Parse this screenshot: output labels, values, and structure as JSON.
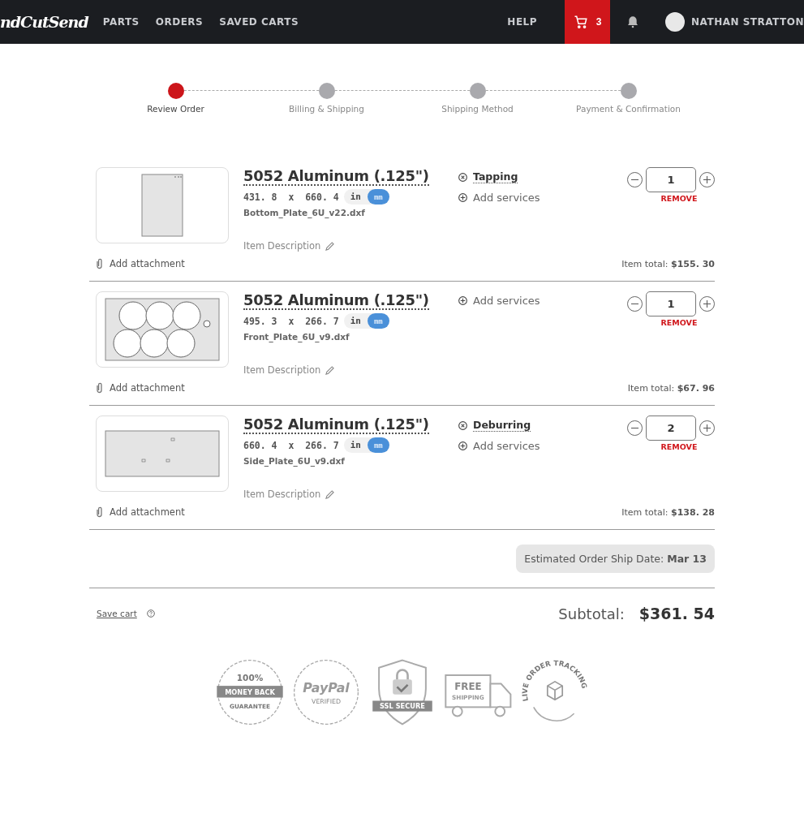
{
  "header": {
    "logo": "ndCutSend",
    "nav": [
      "PARTS",
      "ORDERS",
      "SAVED CARTS"
    ],
    "help": "HELP",
    "cart_count": "3",
    "user_name": "NATHAN STRATTON"
  },
  "steps": [
    {
      "label": "Review Order",
      "selected": true
    },
    {
      "label": "Billing & Shipping",
      "selected": false
    },
    {
      "label": "Shipping Method",
      "selected": false
    },
    {
      "label": "Payment & Confirmation",
      "selected": false
    }
  ],
  "items": [
    {
      "kind": "tall",
      "title": "5052 Aluminum (.125\")",
      "dimensions": "431. 8  x  660. 4",
      "units": [
        {
          "label": "in",
          "selected": false
        },
        {
          "label": "mm",
          "selected": true
        }
      ],
      "file": "Bottom_Plate_6U_v22.dxf",
      "description": "Item Description",
      "attachment": "Add attachment",
      "services": [
        {
          "kind": "service",
          "label": "Tapping"
        },
        {
          "kind": "add",
          "label": "Add services"
        }
      ],
      "quantity": "1",
      "remove": "REMOVE",
      "total_label": "Item total:",
      "total": "$155. 30"
    },
    {
      "kind": "holes",
      "title": "5052 Aluminum (.125\")",
      "dimensions": "495. 3  x  266. 7",
      "units": [
        {
          "label": "in",
          "selected": false
        },
        {
          "label": "mm",
          "selected": true
        }
      ],
      "file": "Front_Plate_6U_v9.dxf",
      "description": "Item Description",
      "attachment": "Add attachment",
      "services": [
        {
          "kind": "add",
          "label": "Add services"
        }
      ],
      "quantity": "1",
      "remove": "REMOVE",
      "total_label": "Item total:",
      "total": "$67. 96"
    },
    {
      "kind": "wide",
      "title": "5052 Aluminum (.125\")",
      "dimensions": "660. 4  x  266. 7",
      "units": [
        {
          "label": "in",
          "selected": false
        },
        {
          "label": "mm",
          "selected": true
        }
      ],
      "file": "Side_Plate_6U_v9.dxf",
      "description": "Item Description",
      "attachment": "Add attachment",
      "services": [
        {
          "kind": "service",
          "label": "Deburring"
        },
        {
          "kind": "add",
          "label": "Add services"
        }
      ],
      "quantity": "2",
      "remove": "REMOVE",
      "total_label": "Item total:",
      "total": "$138. 28"
    }
  ],
  "ship_date": {
    "label": "Estimated Order Ship Date:",
    "value": "Mar 13"
  },
  "save_cart": "Save cart",
  "subtotal": {
    "label": "Subtotal:",
    "value": "$361. 54"
  },
  "badges": [
    {
      "kind": "money_back",
      "lines": [
        "100%",
        "MONEY BACK",
        "GUARANTEE"
      ]
    },
    {
      "kind": "paypal",
      "lines": [
        "PayPal",
        "VERIFIED"
      ]
    },
    {
      "kind": "ssl",
      "lines": [
        "SSL SECURE"
      ]
    },
    {
      "kind": "shipping",
      "lines": [
        "FREE",
        "SHIPPING"
      ]
    },
    {
      "kind": "tracking",
      "lines": [
        "LIVE ORDER TRACKING"
      ]
    }
  ]
}
